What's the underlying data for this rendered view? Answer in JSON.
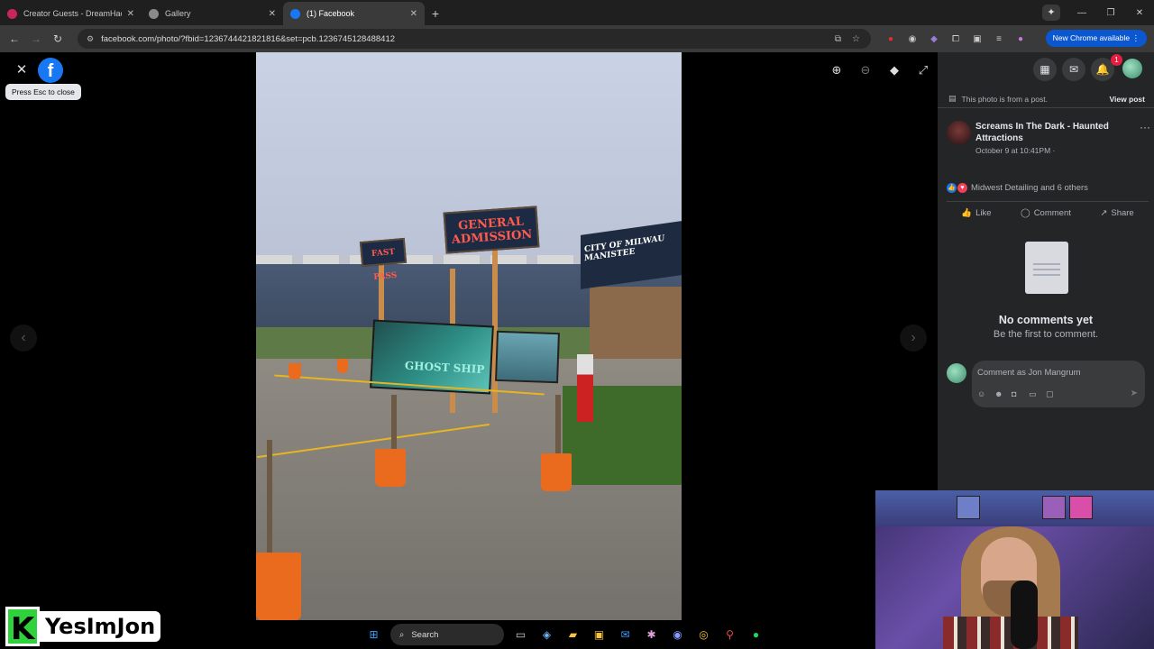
{
  "browser": {
    "tabs": [
      {
        "title": "Creator Guests - DreamHack At",
        "favicon_color": "#c8255d",
        "active": false
      },
      {
        "title": "Gallery",
        "favicon_color": "#8a8a8a",
        "active": false
      },
      {
        "title": "(1) Facebook",
        "favicon_color": "#1877f2",
        "active": true
      }
    ],
    "url": "facebook.com/photo/?fbid=1236744421821816&set=pcb.1236745128488412",
    "new_chrome_label": "New Chrome available"
  },
  "viewer": {
    "tooltip": "Press Esc to close",
    "fb_logo": "f",
    "photo_signs": {
      "general_admission": "GENERAL ADMISSION",
      "fast_pass": "FAST PASS",
      "ship_text": "CITY OF MILWAU MANISTEE",
      "banner_text": "GHOST SHIP"
    }
  },
  "panel": {
    "from_post_text": "This photo is from a post.",
    "view_post_label": "View post",
    "author_name": "Screams In The Dark - Haunted Attractions",
    "timestamp": "October 9 at 10:41PM ·",
    "reactions_text": "Midwest Detailing and 6 others",
    "actions": {
      "like": "Like",
      "comment": "Comment",
      "share": "Share"
    },
    "no_comments_title": "No comments yet",
    "no_comments_sub": "Be the first to comment.",
    "comment_placeholder": "Comment as Jon Mangrum",
    "notification_count": "1"
  },
  "watermark": {
    "letter": "K",
    "name": "YesImJon"
  },
  "taskbar": {
    "search_label": "Search"
  },
  "colors": {
    "facebook_blue": "#1877f2",
    "panel_bg": "#242526",
    "chrome_blue": "#0b57d0"
  }
}
